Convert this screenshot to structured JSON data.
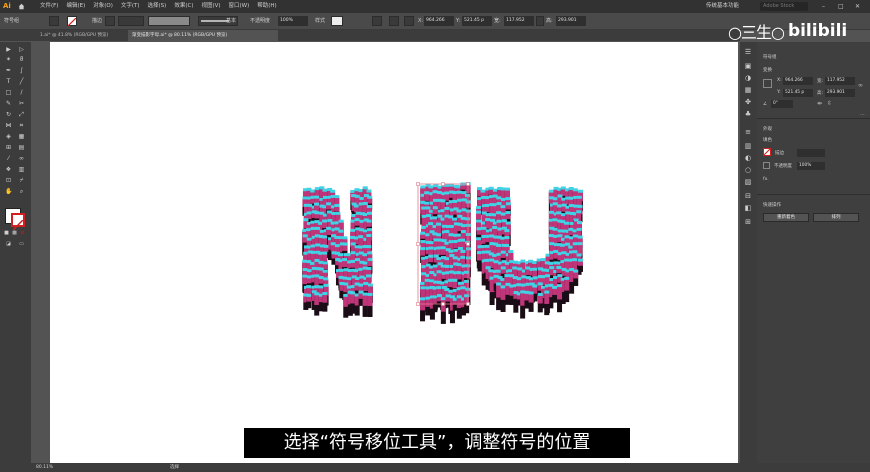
{
  "app": {
    "logo": "Ai",
    "workspace": "传统基本功能",
    "search_placeholder": "Adobe Stock"
  },
  "menu": [
    "文件(F)",
    "编辑(E)",
    "对象(O)",
    "文字(T)",
    "选择(S)",
    "效果(C)",
    "视图(V)",
    "窗口(W)",
    "帮助(H)"
  ],
  "control_bar": {
    "object_type": "符号组",
    "stroke_label": "描边",
    "style_label": "基本",
    "opacity_label": "不透明度",
    "opacity_value": "100%",
    "style_text": "样式",
    "x_value": "964.266",
    "y_value": "521.45 p",
    "w_value": "117.952",
    "h_value": "293.901"
  },
  "tabs": [
    {
      "label": "1.ai* @ 41.8% (RGB/GPU 预览)",
      "active": false
    },
    {
      "label": "渐变描影字母.ai* @ 80.11% (RGB/GPU 预览)",
      "active": true
    }
  ],
  "properties": {
    "header": "符号组",
    "transform_label": "变换",
    "x": "964.266",
    "y": "521.45 p",
    "w": "117.952",
    "h": "293.901",
    "angle": "0°",
    "appearance_label": "外观",
    "fill_label": "填色",
    "stroke_label": "描边",
    "opacity_label": "不透明度",
    "opacity_value": "100%",
    "fx_label": "fx.",
    "quick_actions_label": "快速操作",
    "btn_expand": "重新着色",
    "btn_arrange": "排列"
  },
  "status": {
    "zoom": "80.11%",
    "tool": "选择"
  },
  "subtitle": "选择“符号移位工具”，调整符号的位置",
  "watermark": {
    "left": "○三生○",
    "right": "bilibili"
  },
  "colors": {
    "accent_cyan": "#3fd3e6",
    "accent_magenta": "#c0357a",
    "dark": "#1a0d16",
    "selection": "#e07a8a"
  }
}
